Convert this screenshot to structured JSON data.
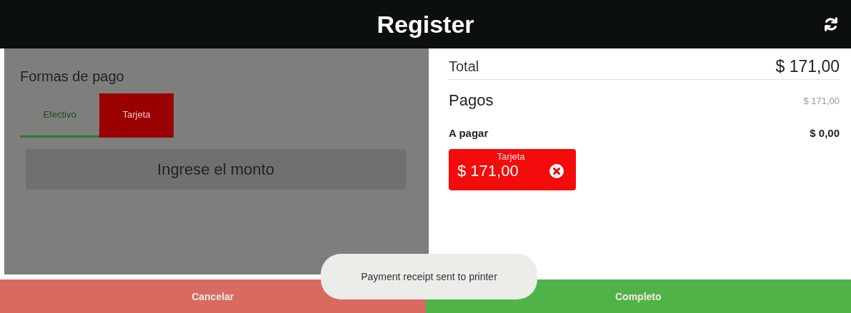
{
  "header": {
    "title": "Register"
  },
  "payment_methods": {
    "title": "Formas de pago",
    "tabs": [
      {
        "label": "Efectivo",
        "selected": true
      },
      {
        "label": "Tarjeta",
        "selected": false
      }
    ],
    "amount_field": {
      "placeholder": "Ingrese el monto"
    }
  },
  "summary": {
    "total": {
      "label": "Total",
      "value": "$ 171,00"
    },
    "payments": {
      "label": "Pagos",
      "value": "$ 171,00"
    },
    "due": {
      "label": "A pagar",
      "value": "$ 0,00"
    },
    "payments_list": [
      {
        "method": "Tarjeta",
        "amount": "$ 171,00"
      }
    ]
  },
  "buttons": [
    {
      "kind": "cancel",
      "label": "Cancelar"
    },
    {
      "kind": "complete",
      "label": "Completo"
    }
  ],
  "toast": "Payment receipt sent to printer"
}
